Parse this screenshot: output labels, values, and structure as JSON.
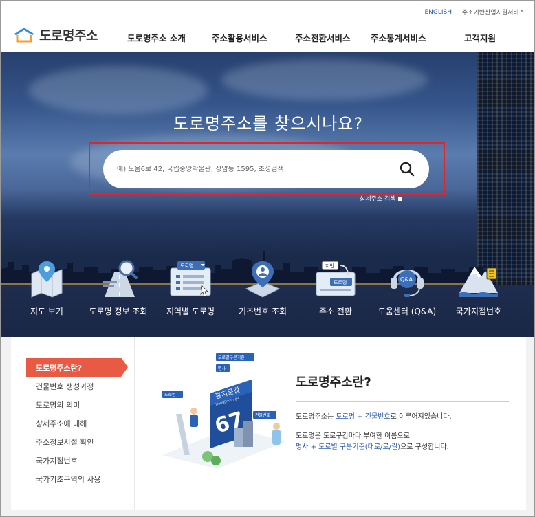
{
  "util": {
    "english": "ENGLISH",
    "industry": "주소기반산업지원서비스"
  },
  "header": {
    "logo": "도로명주소",
    "gnb": [
      "도로명주소 소개",
      "주소활용서비스",
      "주소전환서비스",
      "주소통계서비스",
      "고객지원"
    ]
  },
  "hero": {
    "title": "도로명주소를 찾으시나요?",
    "search_placeholder": "예) 도움6로 42, 국립중앙박물관, 상암동 1595, 초성검색",
    "detail_link": "상세주소 검색"
  },
  "services": [
    {
      "label": "지도 보기",
      "icon": "map-icon"
    },
    {
      "label": "도로명 정보 조회",
      "icon": "road-search-icon"
    },
    {
      "label": "지역별 도로명",
      "icon": "region-list-icon"
    },
    {
      "label": "기초번호 조회",
      "icon": "base-number-icon"
    },
    {
      "label": "주소 전환",
      "icon": "address-convert-icon"
    },
    {
      "label": "도움센터 (Q&A)",
      "icon": "qa-headset-icon"
    },
    {
      "label": "국가지점번호",
      "icon": "mountain-icon"
    }
  ],
  "service_badges": {
    "road": "도로명",
    "jibun": "지번",
    "road2": "도로명",
    "qa": "Q&A"
  },
  "lnb": {
    "active": "도로명주소란?",
    "items": [
      "건물번호 생성과정",
      "도로명의 의미",
      "상세주소에 대해",
      "주소정보시설 확인",
      "국가지점번호",
      "국가기초구역의 사용"
    ]
  },
  "illustration": {
    "sign_road": "홍지문길",
    "sign_road_en": "Hongjimun-gil",
    "sign_number": "67",
    "tag_standard": "도로별구분기준",
    "tag_name": "명사",
    "tag_road": "도로명",
    "tag_building": "건물번호"
  },
  "info": {
    "title": "도로명주소란?",
    "p1_pre": "도로명주소는 ",
    "p1_road": "도로명",
    "p1_plus": " + ",
    "p1_bldg": "건물번호",
    "p1_post": "로 이루어져있습니다.",
    "p2_line1": "도로명은 도로구간마다 부여한 이름으로",
    "p2_blue": "명사 + 도로별 구분기준(대로/로/길)",
    "p2_post": "으로 구성합니다."
  },
  "colors": {
    "accent": "#e95a45",
    "link": "#2a5bb0",
    "highlight": "#e0262b"
  }
}
